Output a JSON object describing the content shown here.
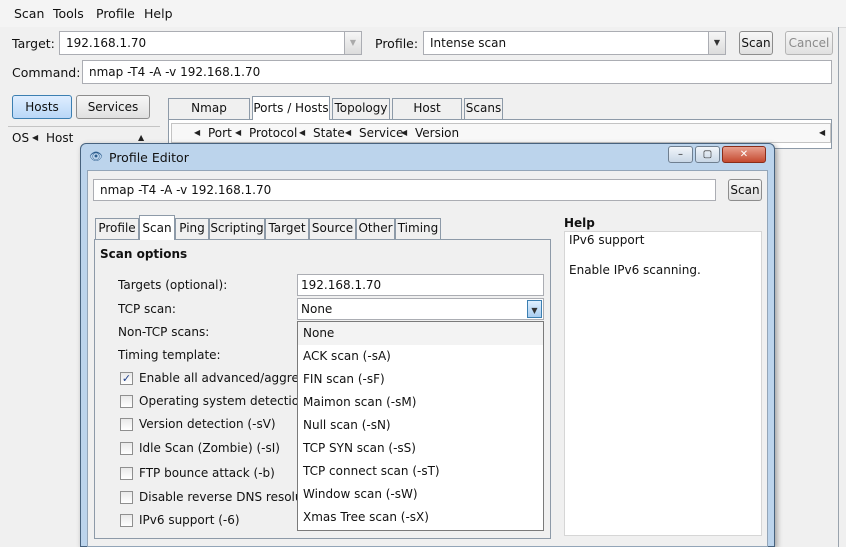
{
  "menu": [
    "Scan",
    "Tools",
    "Profile",
    "Help"
  ],
  "main": {
    "target_label": "Target:",
    "target_value": "192.168.1.70",
    "profile_label": "Profile:",
    "profile_value": "Intense scan",
    "scan_button": "Scan",
    "cancel_button": "Cancel",
    "command_label": "Command:",
    "command_value": "nmap -T4 -A -v 192.168.1.70",
    "hosts_button": "Hosts",
    "services_button": "Services",
    "host_list_headers": [
      "OS",
      "Host"
    ],
    "tabs": [
      "Nmap Output",
      "Ports / Hosts",
      "Topology",
      "Host Details",
      "Scans"
    ],
    "selected_tab": "Ports / Hosts",
    "port_columns": [
      "Port",
      "Protocol",
      "State",
      "Service",
      "Version"
    ]
  },
  "dialog": {
    "title": "Profile Editor",
    "command_value": "nmap -T4 -A -v 192.168.1.70",
    "scan_button": "Scan",
    "tabs": [
      "Profile",
      "Scan",
      "Ping",
      "Scripting",
      "Target",
      "Source",
      "Other",
      "Timing"
    ],
    "selected_tab": "Scan",
    "section_title": "Scan options",
    "targets_label": "Targets (optional):",
    "targets_value": "192.168.1.70",
    "tcp_scan_label": "TCP scan:",
    "tcp_scan_value": "None",
    "non_tcp_label": "Non-TCP scans:",
    "timing_label": "Timing template:",
    "options": [
      {
        "label": "Enable all advanced/aggressive",
        "checked": true
      },
      {
        "label": "Operating system detection (-",
        "checked": false
      },
      {
        "label": "Version detection (-sV)",
        "checked": false
      },
      {
        "label": "Idle Scan (Zombie) (-sI)",
        "checked": false
      },
      {
        "label": "FTP bounce attack (-b)",
        "checked": false
      },
      {
        "label": "Disable reverse DNS resolution",
        "checked": false
      },
      {
        "label": "IPv6 support (-6)",
        "checked": false
      }
    ],
    "tcp_scan_options": [
      "None",
      "ACK scan (-sA)",
      "FIN scan (-sF)",
      "Maimon scan (-sM)",
      "Null scan (-sN)",
      "TCP SYN scan (-sS)",
      "TCP connect scan (-sT)",
      "Window scan (-sW)",
      "Xmas Tree scan (-sX)"
    ],
    "help_title": "Help",
    "help_heading": "IPv6 support",
    "help_text": "Enable IPv6 scanning.",
    "window_buttons": {
      "minimize": "–",
      "maximize": "▢",
      "close": "✕"
    }
  },
  "icons": {
    "app_icon": "eye-icon",
    "dropdown": "chevron-down-icon",
    "sort": "triangle-left-icon"
  },
  "colors": {
    "accent": "#3c7fb1",
    "title_bar": "#bcd4ec",
    "close": "#c54a30"
  }
}
